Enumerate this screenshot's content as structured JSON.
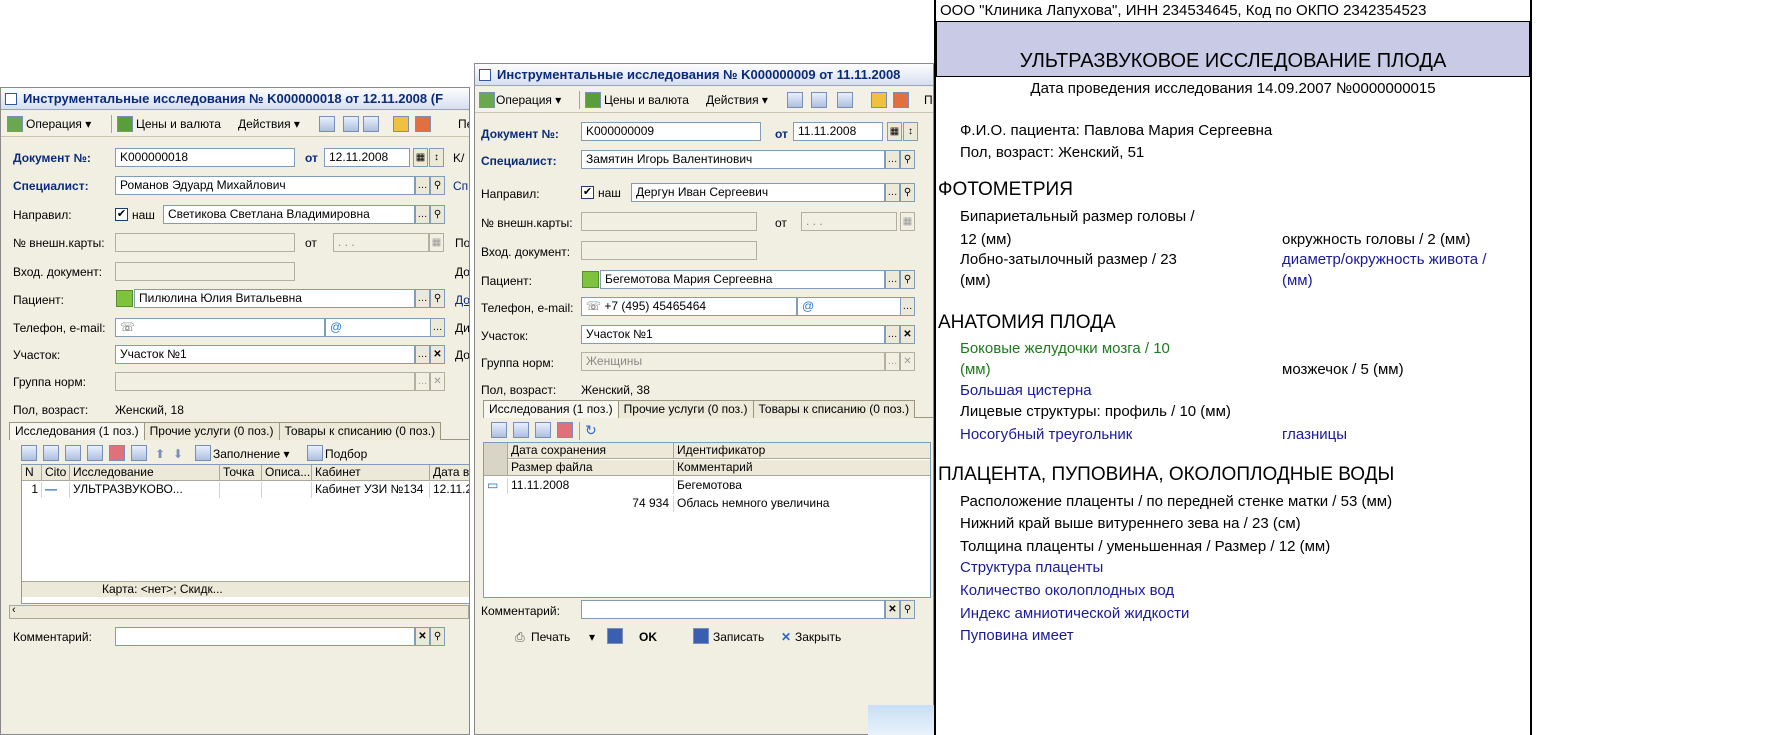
{
  "win1": {
    "title": "Инструментальные исследования № K000000018 от 12.11.2008 (F",
    "toolbar": {
      "operation": "Операция ▾",
      "prices": "Цены и валюта",
      "actions": "Действия ▾",
      "more": "Пе"
    },
    "doc_label": "Документ №:",
    "doc_no": "K000000018",
    "from_label": "от",
    "date": "12.11.2008",
    "date_trunc": "K/",
    "spec_label": "Специалист:",
    "spec_value": "Романов Эдуард Михайлович",
    "spec_trunc": "Сп",
    "ref_label": "Направил:",
    "ref_check": "наш",
    "ref_value": "Светикова Светлана Владимировна",
    "card_label": "№ внешн.карты:",
    "card_from": "от",
    "card_date": ". . .",
    "card_trunc": "По",
    "in_doc_label": "Вход. документ:",
    "in_doc_trunc": "До",
    "patient_label": "Пациент:",
    "patient_value": "Пилюлина Юлия Витальевна",
    "patient_trunc": "До",
    "phone_label": "Телефон, e-mail:",
    "phone_trunc": "Ди",
    "area_label": "Участок:",
    "area_value": "Участок №1",
    "area_trunc": "До",
    "norm_label": "Группа норм:",
    "sex_label": "Пол, возраст:",
    "sex_value": "Женский, 18",
    "tabs": [
      "Исследования (1 поз.)",
      "Прочие услуги (0 поз.)",
      "Товары к списанию (0 поз.)"
    ],
    "grid_toolbar": {
      "fill": "Заполнение ▾",
      "pick": "Подбор"
    },
    "grid_headers": [
      "N",
      "Cito",
      "Исследование",
      "Точка",
      "Описа...",
      "Кабинет",
      "Дата в"
    ],
    "grid_row": [
      "1",
      "—",
      "УЛЬТРАЗВУКОВО...",
      "",
      "",
      "Кабинет УЗИ №134",
      "12.11.2"
    ],
    "grid_footer": "Карта: <нет>; Скидк...",
    "comment_label": "Комментарий:"
  },
  "win2": {
    "title": "Инструментальные исследования № K000000009 от 11.11.2008",
    "toolbar": {
      "operation": "Операция ▾",
      "prices": "Цены и валюта",
      "actions": "Действия ▾",
      "more": "П"
    },
    "doc_label": "Документ №:",
    "doc_no": "K000000009",
    "from_label": "от",
    "date": "11.11.2008",
    "spec_label": "Специалист:",
    "spec_value": "Замятин Игорь Валентинович",
    "ref_label": "Направил:",
    "ref_check": "наш",
    "ref_value": "Дергун Иван Сергеевич",
    "card_label": "№ внешн.карты:",
    "card_from": "от",
    "card_date": ". . .",
    "in_doc_label": "Вход. документ:",
    "patient_label": "Пациент:",
    "patient_value": "Бегемотова Мария  Сергеевна",
    "phone_label": "Телефон, e-mail:",
    "phone_value": "+7 (495) 45465464",
    "area_label": "Участок:",
    "area_value": "Участок №1",
    "norm_label": "Группа норм:",
    "norm_value": "Женщины",
    "sex_label": "Пол, возраст:",
    "sex_value": "Женский, 38",
    "tabs": [
      "Исследования (1 поз.)",
      "Прочие услуги (0 поз.)",
      "Товары к списанию (0 поз.)"
    ],
    "grid_headers": [
      "Дата сохранения",
      "Идентификатор",
      "Размер файла",
      "Комментарий"
    ],
    "grid_rows": [
      [
        "11.11.2008",
        "Бегемотова"
      ],
      [
        "74 934",
        "Облась немного увеличина"
      ]
    ],
    "comment_label": "Комментарий:",
    "bottom": {
      "print": "Печать",
      "ok": "OK",
      "save": "Записать",
      "close": "Закрыть"
    }
  },
  "report": {
    "org": "ООО \"Клиника Лапухова\", ИНН 234534645, Код по ОКПО 2342354523",
    "title": "УЛЬТРАЗВУКОВОЕ ИССЛЕДОВАНИЕ ПЛОДА",
    "date_line": "Дата проведения исследования 14.09.2007 №0000000015",
    "patient": "Ф.И.О. пациента: Павлова Мария Сергеевна",
    "sex_age": "Пол, возраст: Женский, 51",
    "sec1": "ФОТОМЕТРИЯ",
    "s1_l1": "Бипариетальный размер головы /",
    "s1_l2": "12 (мм)",
    "s1_r2": "окружность головы / 2 (мм)",
    "s1_l3": "Лобно-затылочный размер / 23",
    "s1_r3": "диаметр/окружность живота  /",
    "s1_l4": "(мм)",
    "s1_r4": "(мм)",
    "sec2": "АНАТОМИЯ ПЛОДА",
    "s2_l1": "Боковые желудочки мозга / 10",
    "s2_l2": "(мм)",
    "s2_r2": "мозжечок / 5 (мм)",
    "s2_l3": "Большая цистерна",
    "s2_l4": "Лицевые структуры: профиль / 10 (мм)",
    "s2_l5": "Носогубный треугольник",
    "s2_r5": "глазницы",
    "sec3": "ПЛАЦЕНТА, ПУПОВИНА, ОКОЛОПЛОДНЫЕ ВОДЫ",
    "s3_l1": "Расположение плаценты / по передней стенке матки / 53 (мм)",
    "s3_l2": "Нижний край выше витуреннего зева на / 23 (см)",
    "s3_l3": "Толщина плаценты / уменьшенная / Размер / 12 (мм)",
    "s3_l4": "Структура плаценты",
    "s3_l5": "Количество околоплодных вод",
    "s3_l6": "Индекс амниотической жидкости",
    "s3_l7": "Пуповина имеет"
  }
}
